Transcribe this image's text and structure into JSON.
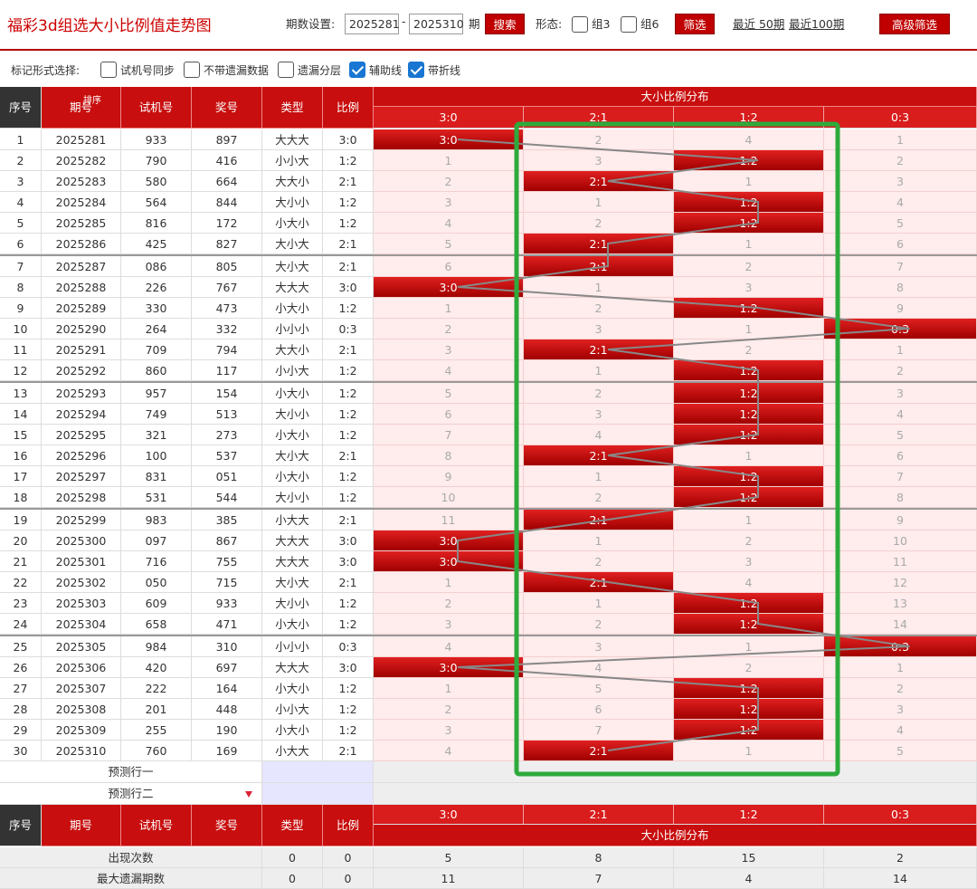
{
  "header": {
    "title": "福彩3d组选大小比例值走势图",
    "period_label": "期数设置:",
    "from": "2025281",
    "dash": "-",
    "to": "2025310",
    "period_suffix": "期",
    "search_btn": "搜索",
    "form_label": "形态:",
    "zu3": "组3",
    "zu6": "组6",
    "filter_btn": "筛选",
    "recent50": "最近 50期",
    "recent100": "最近100期",
    "advanced_btn": "高级筛选"
  },
  "markbar": {
    "label": "标记形式选择:",
    "options": [
      {
        "label": "试机号同步",
        "checked": false
      },
      {
        "label": "不带遗漏数据",
        "checked": false
      },
      {
        "label": "遗漏分层",
        "checked": false
      },
      {
        "label": "辅助线",
        "checked": true
      },
      {
        "label": "带折线",
        "checked": true
      }
    ]
  },
  "table": {
    "headers": {
      "seq": "序号",
      "issue": "期号",
      "sort": "排序",
      "trial": "试机号",
      "draw": "奖号",
      "type": "类型",
      "ratio": "比例",
      "dist": "大小比例分布"
    },
    "ratio_cols": [
      "3:0",
      "2:1",
      "1:2",
      "0:3"
    ],
    "rows": [
      {
        "seq": "1",
        "issue": "2025281",
        "trial": "933",
        "draw": "897",
        "type": "大大大",
        "ratio": "3:0",
        "hit": 0,
        "cells": [
          "3:0",
          "2",
          "4",
          "1"
        ]
      },
      {
        "seq": "2",
        "issue": "2025282",
        "trial": "790",
        "draw": "416",
        "type": "小小大",
        "ratio": "1:2",
        "hit": 2,
        "cells": [
          "1",
          "3",
          "1:2",
          "2"
        ]
      },
      {
        "seq": "3",
        "issue": "2025283",
        "trial": "580",
        "draw": "664",
        "type": "大大小",
        "ratio": "2:1",
        "hit": 1,
        "cells": [
          "2",
          "2:1",
          "1",
          "3"
        ]
      },
      {
        "seq": "4",
        "issue": "2025284",
        "trial": "564",
        "draw": "844",
        "type": "大小小",
        "ratio": "1:2",
        "hit": 2,
        "cells": [
          "3",
          "1",
          "1:2",
          "4"
        ]
      },
      {
        "seq": "5",
        "issue": "2025285",
        "trial": "816",
        "draw": "172",
        "type": "小大小",
        "ratio": "1:2",
        "hit": 2,
        "cells": [
          "4",
          "2",
          "1:2",
          "5"
        ]
      },
      {
        "seq": "6",
        "issue": "2025286",
        "trial": "425",
        "draw": "827",
        "type": "大小大",
        "ratio": "2:1",
        "hit": 1,
        "cells": [
          "5",
          "2:1",
          "1",
          "6"
        ]
      },
      {
        "seq": "7",
        "issue": "2025287",
        "trial": "086",
        "draw": "805",
        "type": "大小大",
        "ratio": "2:1",
        "hit": 1,
        "cells": [
          "6",
          "2:1",
          "2",
          "7"
        ]
      },
      {
        "seq": "8",
        "issue": "2025288",
        "trial": "226",
        "draw": "767",
        "type": "大大大",
        "ratio": "3:0",
        "hit": 0,
        "cells": [
          "3:0",
          "1",
          "3",
          "8"
        ]
      },
      {
        "seq": "9",
        "issue": "2025289",
        "trial": "330",
        "draw": "473",
        "type": "小大小",
        "ratio": "1:2",
        "hit": 2,
        "cells": [
          "1",
          "2",
          "1:2",
          "9"
        ]
      },
      {
        "seq": "10",
        "issue": "2025290",
        "trial": "264",
        "draw": "332",
        "type": "小小小",
        "ratio": "0:3",
        "hit": 3,
        "cells": [
          "2",
          "3",
          "1",
          "0:3"
        ]
      },
      {
        "seq": "11",
        "issue": "2025291",
        "trial": "709",
        "draw": "794",
        "type": "大大小",
        "ratio": "2:1",
        "hit": 1,
        "cells": [
          "3",
          "2:1",
          "2",
          "1"
        ]
      },
      {
        "seq": "12",
        "issue": "2025292",
        "trial": "860",
        "draw": "117",
        "type": "小小大",
        "ratio": "1:2",
        "hit": 2,
        "cells": [
          "4",
          "1",
          "1:2",
          "2"
        ]
      },
      {
        "seq": "13",
        "issue": "2025293",
        "trial": "957",
        "draw": "154",
        "type": "小大小",
        "ratio": "1:2",
        "hit": 2,
        "cells": [
          "5",
          "2",
          "1:2",
          "3"
        ]
      },
      {
        "seq": "14",
        "issue": "2025294",
        "trial": "749",
        "draw": "513",
        "type": "大小小",
        "ratio": "1:2",
        "hit": 2,
        "cells": [
          "6",
          "3",
          "1:2",
          "4"
        ]
      },
      {
        "seq": "15",
        "issue": "2025295",
        "trial": "321",
        "draw": "273",
        "type": "小大小",
        "ratio": "1:2",
        "hit": 2,
        "cells": [
          "7",
          "4",
          "1:2",
          "5"
        ]
      },
      {
        "seq": "16",
        "issue": "2025296",
        "trial": "100",
        "draw": "537",
        "type": "大小大",
        "ratio": "2:1",
        "hit": 1,
        "cells": [
          "8",
          "2:1",
          "1",
          "6"
        ]
      },
      {
        "seq": "17",
        "issue": "2025297",
        "trial": "831",
        "draw": "051",
        "type": "小大小",
        "ratio": "1:2",
        "hit": 2,
        "cells": [
          "9",
          "1",
          "1:2",
          "7"
        ]
      },
      {
        "seq": "18",
        "issue": "2025298",
        "trial": "531",
        "draw": "544",
        "type": "大小小",
        "ratio": "1:2",
        "hit": 2,
        "cells": [
          "10",
          "2",
          "1:2",
          "8"
        ]
      },
      {
        "seq": "19",
        "issue": "2025299",
        "trial": "983",
        "draw": "385",
        "type": "小大大",
        "ratio": "2:1",
        "hit": 1,
        "cells": [
          "11",
          "2:1",
          "1",
          "9"
        ]
      },
      {
        "seq": "20",
        "issue": "2025300",
        "trial": "097",
        "draw": "867",
        "type": "大大大",
        "ratio": "3:0",
        "hit": 0,
        "cells": [
          "3:0",
          "1",
          "2",
          "10"
        ]
      },
      {
        "seq": "21",
        "issue": "2025301",
        "trial": "716",
        "draw": "755",
        "type": "大大大",
        "ratio": "3:0",
        "hit": 0,
        "cells": [
          "3:0",
          "2",
          "3",
          "11"
        ]
      },
      {
        "seq": "22",
        "issue": "2025302",
        "trial": "050",
        "draw": "715",
        "type": "大小大",
        "ratio": "2:1",
        "hit": 1,
        "cells": [
          "1",
          "2:1",
          "4",
          "12"
        ]
      },
      {
        "seq": "23",
        "issue": "2025303",
        "trial": "609",
        "draw": "933",
        "type": "大小小",
        "ratio": "1:2",
        "hit": 2,
        "cells": [
          "2",
          "1",
          "1:2",
          "13"
        ]
      },
      {
        "seq": "24",
        "issue": "2025304",
        "trial": "658",
        "draw": "471",
        "type": "小大小",
        "ratio": "1:2",
        "hit": 2,
        "cells": [
          "3",
          "2",
          "1:2",
          "14"
        ]
      },
      {
        "seq": "25",
        "issue": "2025305",
        "trial": "984",
        "draw": "310",
        "type": "小小小",
        "ratio": "0:3",
        "hit": 3,
        "cells": [
          "4",
          "3",
          "1",
          "0:3"
        ]
      },
      {
        "seq": "26",
        "issue": "2025306",
        "trial": "420",
        "draw": "697",
        "type": "大大大",
        "ratio": "3:0",
        "hit": 0,
        "cells": [
          "3:0",
          "4",
          "2",
          "1"
        ]
      },
      {
        "seq": "27",
        "issue": "2025307",
        "trial": "222",
        "draw": "164",
        "type": "小大小",
        "ratio": "1:2",
        "hit": 2,
        "cells": [
          "1",
          "5",
          "1:2",
          "2"
        ]
      },
      {
        "seq": "28",
        "issue": "2025308",
        "trial": "201",
        "draw": "448",
        "type": "小小大",
        "ratio": "1:2",
        "hit": 2,
        "cells": [
          "2",
          "6",
          "1:2",
          "3"
        ]
      },
      {
        "seq": "29",
        "issue": "2025309",
        "trial": "255",
        "draw": "190",
        "type": "小大小",
        "ratio": "1:2",
        "hit": 2,
        "cells": [
          "3",
          "7",
          "1:2",
          "4"
        ]
      },
      {
        "seq": "30",
        "issue": "2025310",
        "trial": "760",
        "draw": "169",
        "type": "小大大",
        "ratio": "2:1",
        "hit": 1,
        "cells": [
          "4",
          "2:1",
          "1",
          "5"
        ]
      }
    ],
    "predict1": "预测行一",
    "predict2": "预测行二",
    "stats": [
      {
        "label": "出现次数",
        "type": "0",
        "ratio": "0",
        "vals": [
          "5",
          "8",
          "15",
          "2"
        ]
      },
      {
        "label": "最大遗漏期数",
        "type": "0",
        "ratio": "0",
        "vals": [
          "11",
          "7",
          "4",
          "14"
        ]
      }
    ]
  },
  "colors": {
    "red": "#c80e0e",
    "pink": "#ffecec",
    "highlight": "#2eaa3c",
    "line": "#888888"
  }
}
